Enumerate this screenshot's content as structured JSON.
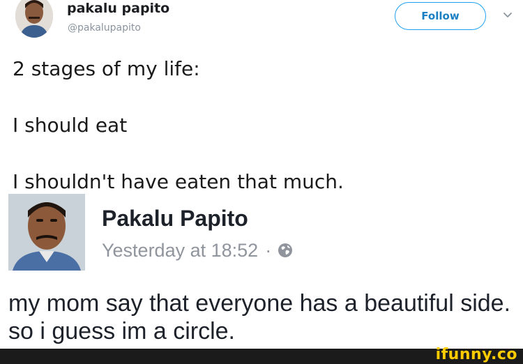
{
  "tweet": {
    "author_name": "pakalu papito",
    "author_handle": "@pakalupapito",
    "follow_label": "Follow",
    "lines": [
      "2 stages of my life:",
      "I should eat",
      "I shouldn't have eaten that much."
    ],
    "icons": [
      "avatar",
      "chevron-down-icon"
    ],
    "accent_color": "#1da1f2"
  },
  "fb_post": {
    "author_name": "Pakalu Papito",
    "timestamp": "Yesterday at 18:52",
    "separator": "·",
    "privacy_icon": "globe-icon",
    "text": "my mom say that everyone has a beautiful side. so i guess im a circle."
  },
  "watermark": {
    "label": "ifunny.co",
    "color": "#ffcc00"
  }
}
